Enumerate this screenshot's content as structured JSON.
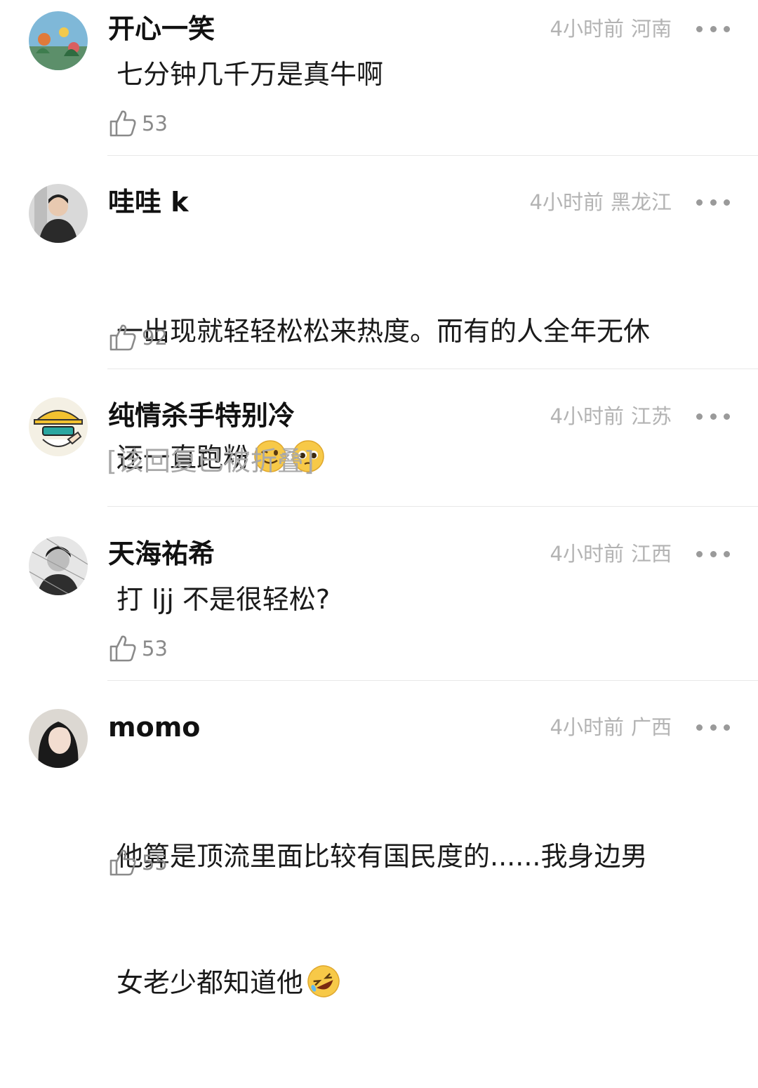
{
  "comments": [
    {
      "username": "开心一笑",
      "time": "4小时前",
      "location": "河南",
      "text": "七分钟几千万是真牛啊",
      "likes": "53"
    },
    {
      "username": "哇哇 k",
      "time": "4小时前",
      "location": "黑龙江",
      "text_line1": "一出现就轻轻松松来热度。而有的人全年无休",
      "text_line2": "还一直跑粉",
      "emojis": [
        "winking-face",
        "pleading-face"
      ],
      "likes": "92"
    },
    {
      "username": "纯情杀手特别冷",
      "time": "4小时前",
      "location": "江苏",
      "text": "[该回复已被折叠]"
    },
    {
      "username": "天海祐希",
      "time": "4小时前",
      "location": "江西",
      "text": "打 ljj 不是很轻松?",
      "likes": "53"
    },
    {
      "username": "momo",
      "time": "4小时前",
      "location": "广西",
      "text_line1": "他算是顶流里面比较有国民度的......我身边男",
      "text_line2": "女老少都知道他",
      "emojis": [
        "rolling-on-floor-laughing"
      ],
      "likes": "55"
    }
  ],
  "colors": {
    "meta": "#b3b3b3",
    "divider": "#e8e8e8",
    "folded": "#a8a8a8"
  }
}
